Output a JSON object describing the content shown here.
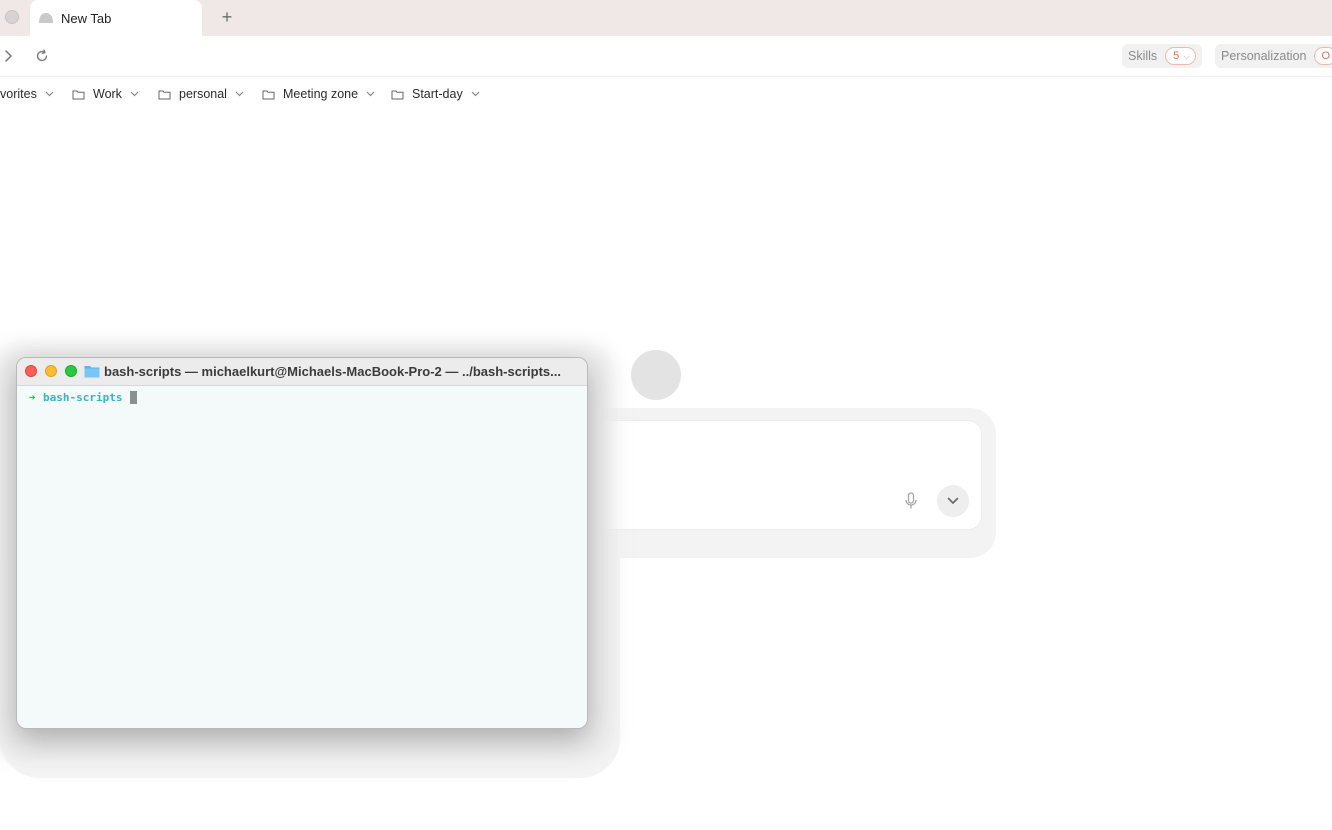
{
  "tabs": {
    "active_title": "New Tab",
    "new_tab_glyph": "+"
  },
  "toolbar": {
    "skills_label": "Skills",
    "skills_count": "5",
    "personalization_label": "Personalization",
    "personalization_count": "O"
  },
  "bookmarks": [
    {
      "label": "vorites",
      "icon": "folder-icon"
    },
    {
      "label": "Work",
      "icon": "folder-icon"
    },
    {
      "label": "personal",
      "icon": "folder-icon"
    },
    {
      "label": "Meeting zone",
      "icon": "folder-icon"
    },
    {
      "label": "Start-day",
      "icon": "folder-icon"
    }
  ],
  "terminal": {
    "title": "bash-scripts — michaelkurt@Michaels-MacBook-Pro-2 — ../bash-scripts...",
    "prompt_arrow": "➜",
    "prompt_dir": "bash-scripts"
  },
  "colors": {
    "tabstrip_bg": "#efe8e6",
    "badge_accent": "#e0714f",
    "terminal_bg": "#f4f9f9",
    "prompt_green": "#29b84a",
    "prompt_cyan": "#34b6c4",
    "traffic_red": "#ff5f57",
    "traffic_yellow": "#febc2e",
    "traffic_green": "#28c840"
  }
}
